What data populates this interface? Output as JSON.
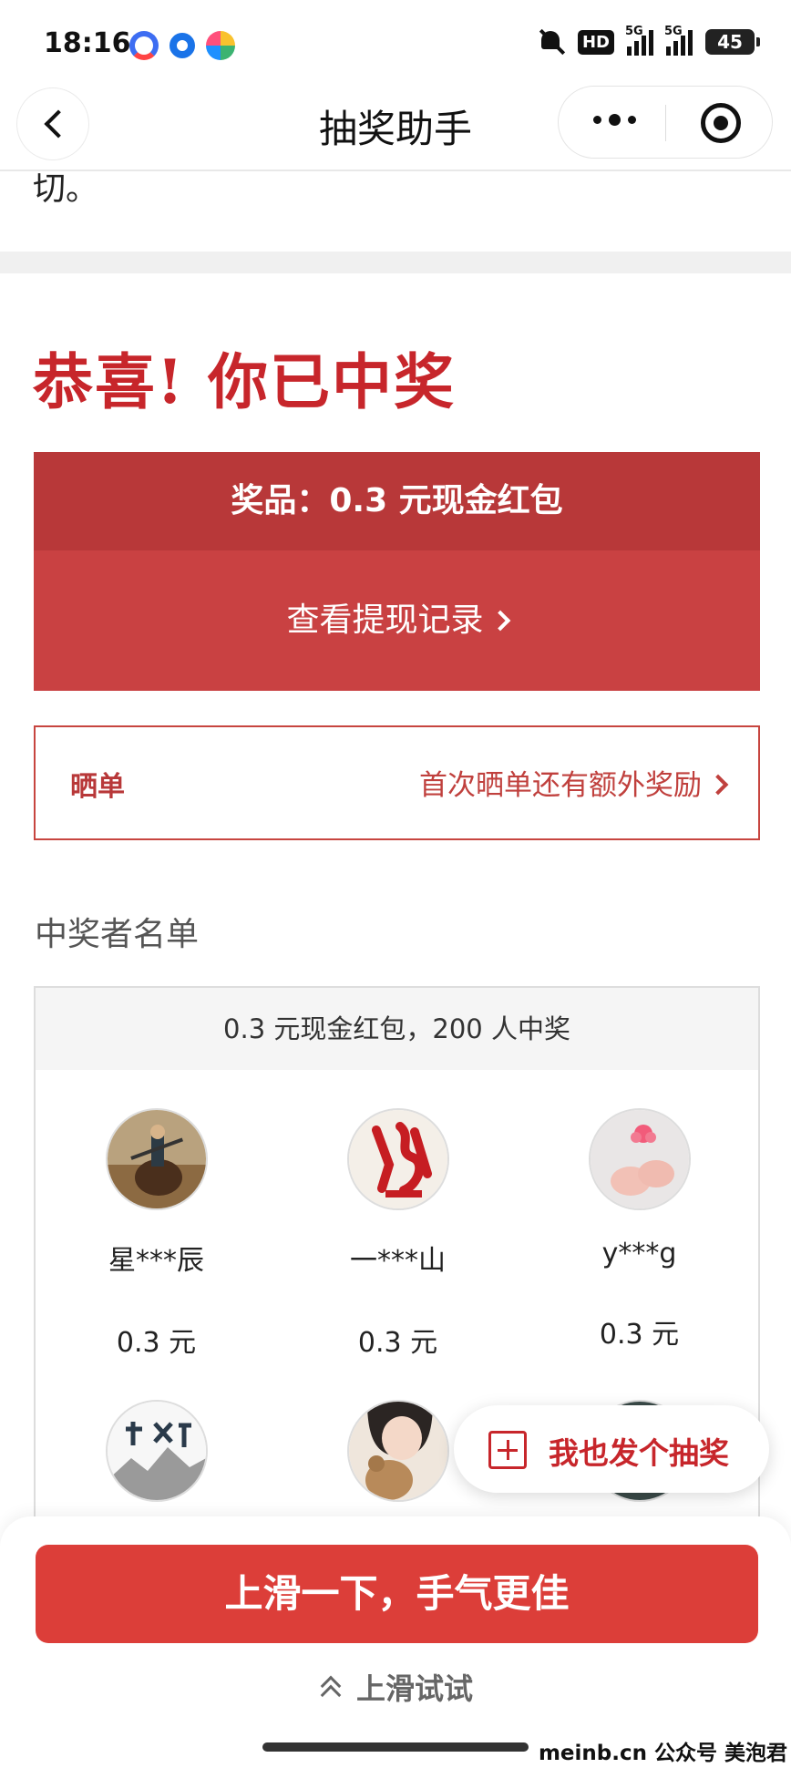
{
  "status_bar": {
    "time": "18:16",
    "hd_label": "HD",
    "network_label_1": "5G",
    "network_label_2": "5G",
    "battery": "45"
  },
  "nav": {
    "title": "抽奖助手"
  },
  "content": {
    "cut_text": "切。",
    "congrats": "恭喜! 你已中奖",
    "prize_label": "奖品：0.3 元现金红包",
    "withdraw_label": "查看提现记录",
    "share_label": "晒单",
    "share_hint": "首次晒单还有额外奖励",
    "winners_title": "中奖者名单",
    "winners_summary": "0.3 元现金红包，200 人中奖"
  },
  "winners": [
    {
      "name": "星***辰",
      "amount": "0.3 元",
      "avatar": "horse-rider-avatar"
    },
    {
      "name": "一***山",
      "amount": "0.3 元",
      "avatar": "calligraphy-avatar"
    },
    {
      "name": "y***g",
      "amount": "0.3 元",
      "avatar": "baby-feet-avatar"
    },
    {
      "name": "",
      "amount": "",
      "avatar": "ink-mountain-avatar"
    },
    {
      "name": "",
      "amount": "",
      "avatar": "girl-teddy-avatar"
    },
    {
      "name": "",
      "amount": "",
      "avatar": "dark-avatar"
    }
  ],
  "float_button": {
    "label": "我也发个抽奖"
  },
  "bottom": {
    "cta": "上滑一下，手气更佳",
    "hint": "上滑试试",
    "watermark": "meinb.cn  公众号 美泡君"
  },
  "colors": {
    "brand_red": "#c7262b",
    "prize_header": "#b83839",
    "prize_body": "#c94142",
    "cta_red": "#dc3e39"
  }
}
